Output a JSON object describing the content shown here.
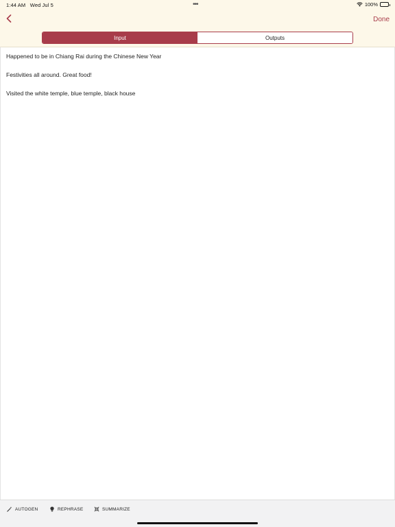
{
  "status_bar": {
    "time": "1:44 AM",
    "date": "Wed Jul 5",
    "battery_percent": "100%"
  },
  "nav": {
    "done_label": "Done",
    "segments": [
      {
        "label": "Input",
        "active": true
      },
      {
        "label": "Outputs",
        "active": false
      }
    ]
  },
  "editor": {
    "lines": [
      "Happened to be in Chiang Rai during the Chinese New Year",
      "Festivities all around. Great food!",
      "Visited the white temple, blue temple, black house"
    ]
  },
  "toolbar": {
    "autogen_label": "AUTOGEN",
    "rephrase_label": "REPHRASE",
    "summarize_label": "SUMMARIZE"
  },
  "colors": {
    "accent": "#a83c4a",
    "background": "#fdf8e9"
  },
  "icons": {
    "back": "chevron-left-icon",
    "autogen": "magic-wand-icon",
    "rephrase": "lightbulb-icon",
    "summarize": "compress-icon"
  }
}
